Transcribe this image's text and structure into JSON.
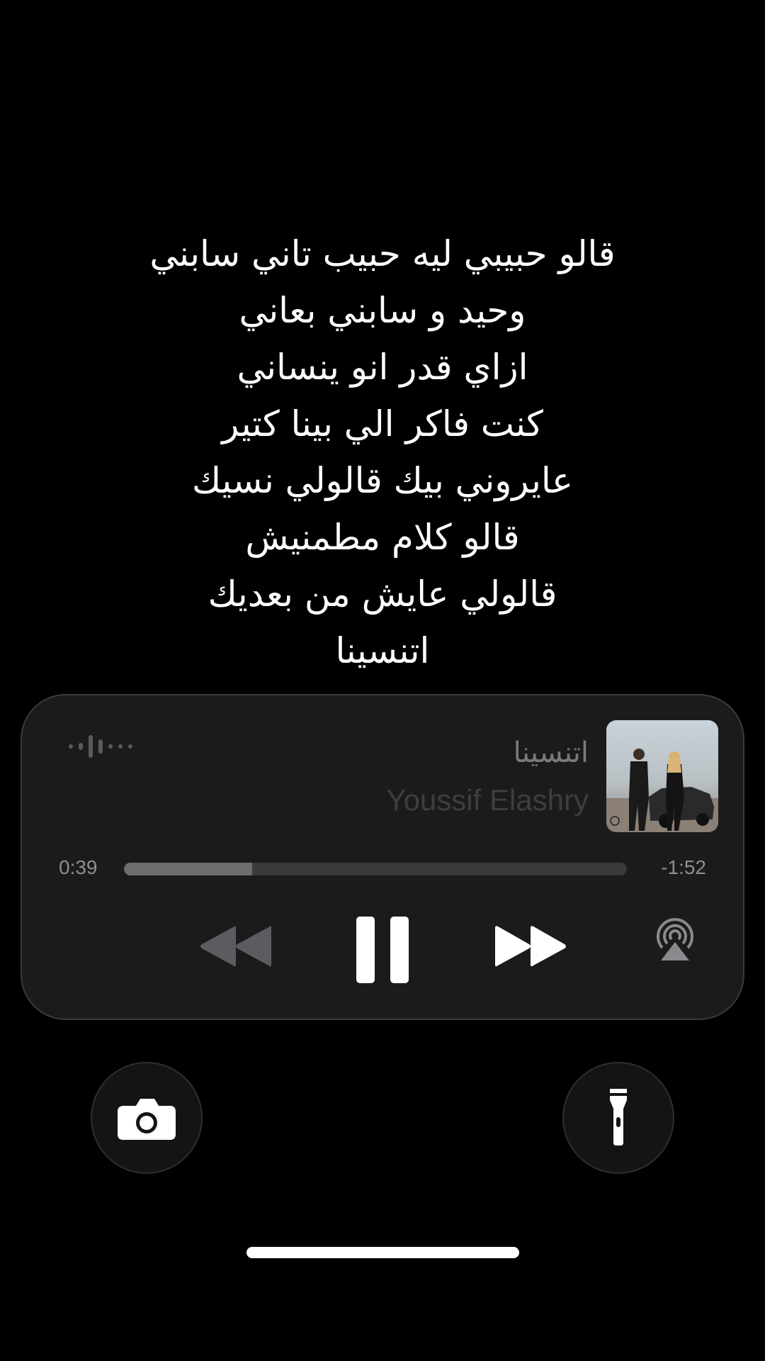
{
  "lyrics": {
    "lines": [
      "قالو حبيبي ليه حبيب تاني سابني",
      "وحيد و سابني بعاني",
      "ازاي قدر انو ينساني",
      "كنت فاكر الي بينا كتير",
      "عايروني بيك قالولي نسيك",
      "قالو كلام مطمنيش",
      "قالولي عايش من بعديك",
      "اتنسينا"
    ]
  },
  "now_playing": {
    "title": "اتنسينا",
    "artist": "Youssif Elashry",
    "elapsed": "0:39",
    "remaining": "-1:52",
    "progress_fraction": 0.255,
    "artwork_icon": "album-artwork"
  },
  "controls": {
    "back_icon": "rewind-icon",
    "pause_icon": "pause-icon",
    "forward_icon": "fast-forward-icon",
    "airplay_icon": "airplay-icon",
    "waveform_icon": "audio-waveform-icon"
  },
  "quick_actions": {
    "camera_icon": "camera-icon",
    "flashlight_icon": "flashlight-icon"
  },
  "colors": {
    "background": "#000000",
    "player_background": "#1b1b1c",
    "primary_text": "#ffffff",
    "secondary_text": "#8e8e93",
    "progress_fill": "#6d6d70",
    "progress_track": "#3a3a3c"
  }
}
